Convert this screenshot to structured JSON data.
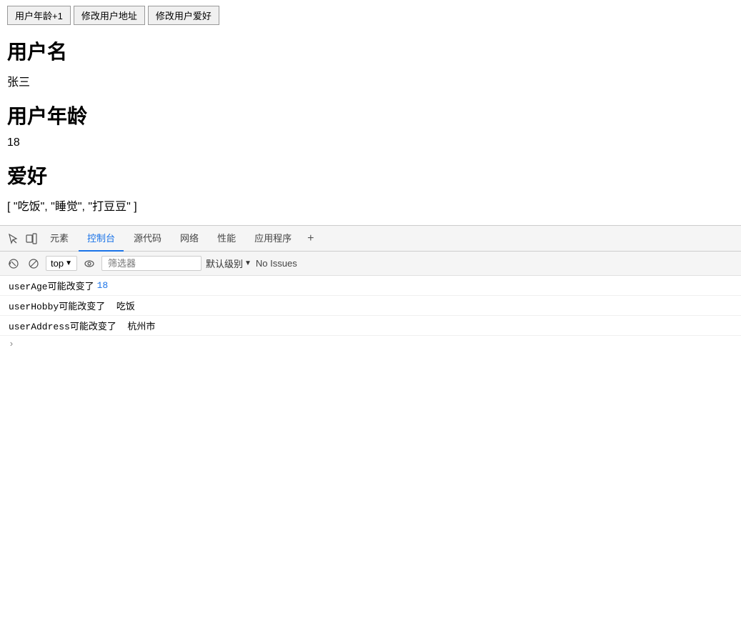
{
  "buttons": {
    "increment_age": "用户年龄+1",
    "modify_address": "修改用户地址",
    "modify_hobby": "修改用户爱好"
  },
  "sections": {
    "username_label": "用户名",
    "username_value": "张三",
    "age_label": "用户年龄",
    "age_value": "18",
    "hobby_label": "爱好",
    "hobby_value": "[ \"吃饭\", \"睡觉\", \"打豆豆\" ]"
  },
  "devtools": {
    "tabs": [
      {
        "id": "elements",
        "label": "元素"
      },
      {
        "id": "console",
        "label": "控制台"
      },
      {
        "id": "source",
        "label": "源代码"
      },
      {
        "id": "network",
        "label": "网络"
      },
      {
        "id": "performance",
        "label": "性能"
      },
      {
        "id": "application",
        "label": "应用程序"
      }
    ],
    "toolbar": {
      "context": "top",
      "filter_placeholder": "筛选器",
      "level": "默认级别",
      "no_issues": "No Issues"
    },
    "logs": [
      {
        "text": "userAge可能改变了",
        "highlight": "18"
      },
      {
        "text": "userHobby可能改变了  吃饭",
        "highlight": ""
      },
      {
        "text": "userAddress可能改变了  杭州市",
        "highlight": ""
      }
    ]
  }
}
